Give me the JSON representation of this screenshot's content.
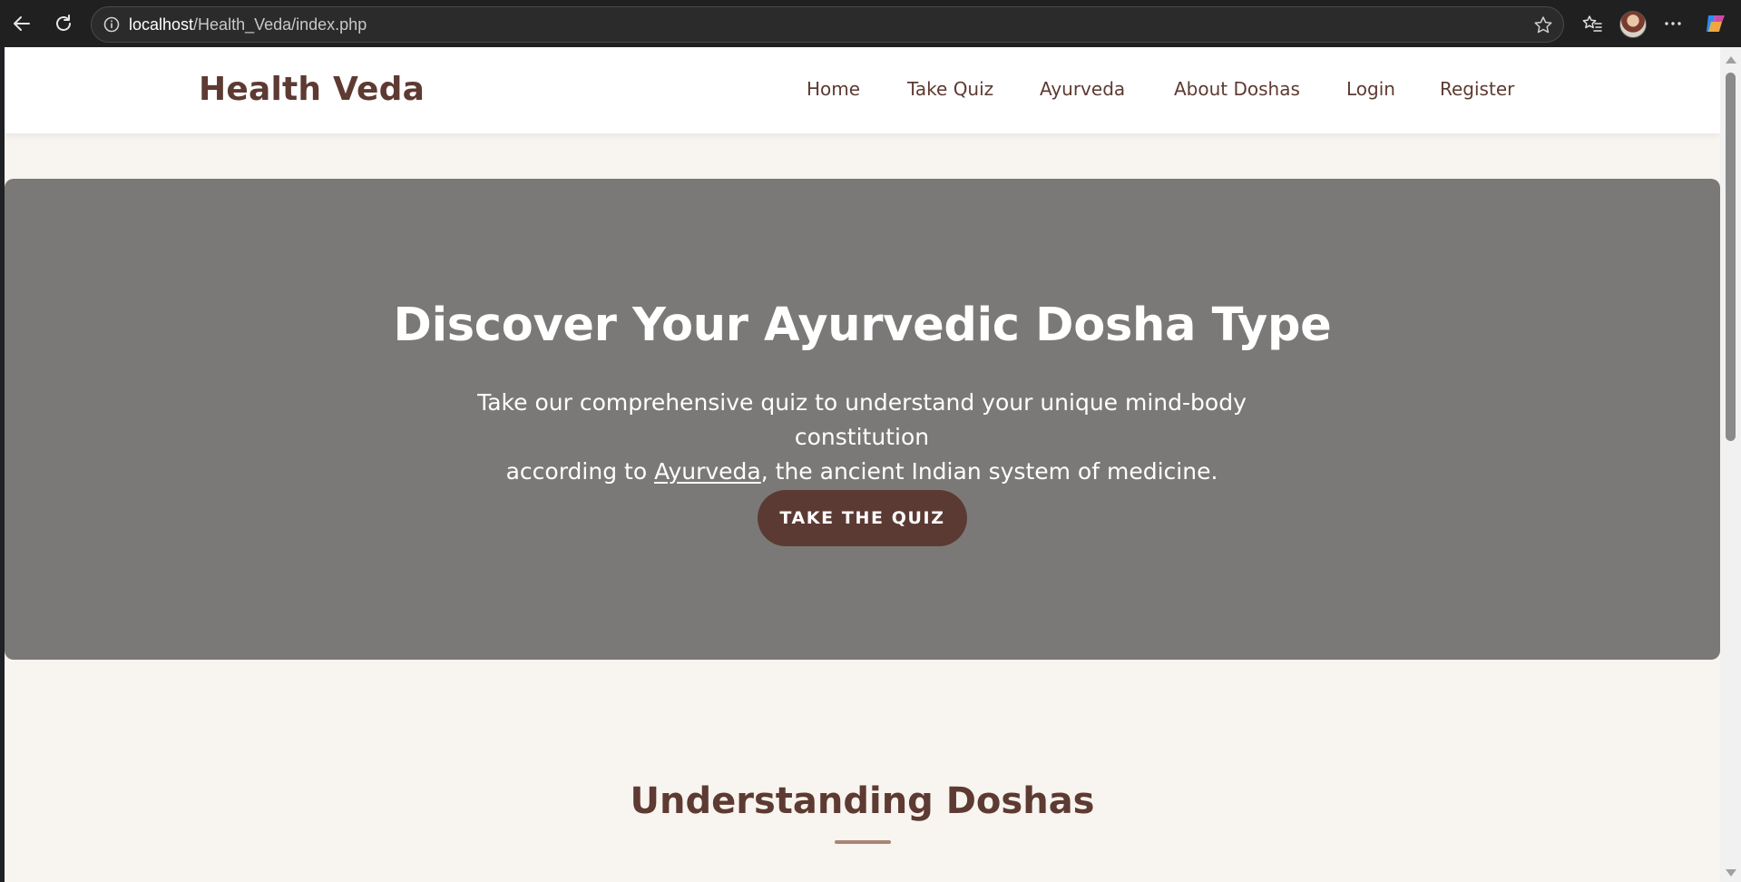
{
  "browser": {
    "url_host": "localhost",
    "url_path": "/Health_Veda/index.php"
  },
  "site": {
    "logo": "Health Veda",
    "nav": [
      {
        "label": "Home"
      },
      {
        "label": "Take Quiz"
      },
      {
        "label": "Ayurveda"
      },
      {
        "label": "About Doshas"
      },
      {
        "label": "Login"
      },
      {
        "label": "Register"
      }
    ]
  },
  "hero": {
    "title": "Discover Your Ayurvedic Dosha Type",
    "lead_line1": "Take our comprehensive quiz to understand your unique mind-body constitution",
    "lead_pre": "according to ",
    "lead_link": "Ayurveda",
    "lead_post": ", the ancient Indian system of medicine.",
    "cta_label": "TAKE THE QUIZ"
  },
  "section": {
    "title": "Understanding Doshas"
  },
  "colors": {
    "brand_brown": "#5d3a32",
    "hero_bg": "#7b7977",
    "page_bg": "#f8f4ef"
  }
}
